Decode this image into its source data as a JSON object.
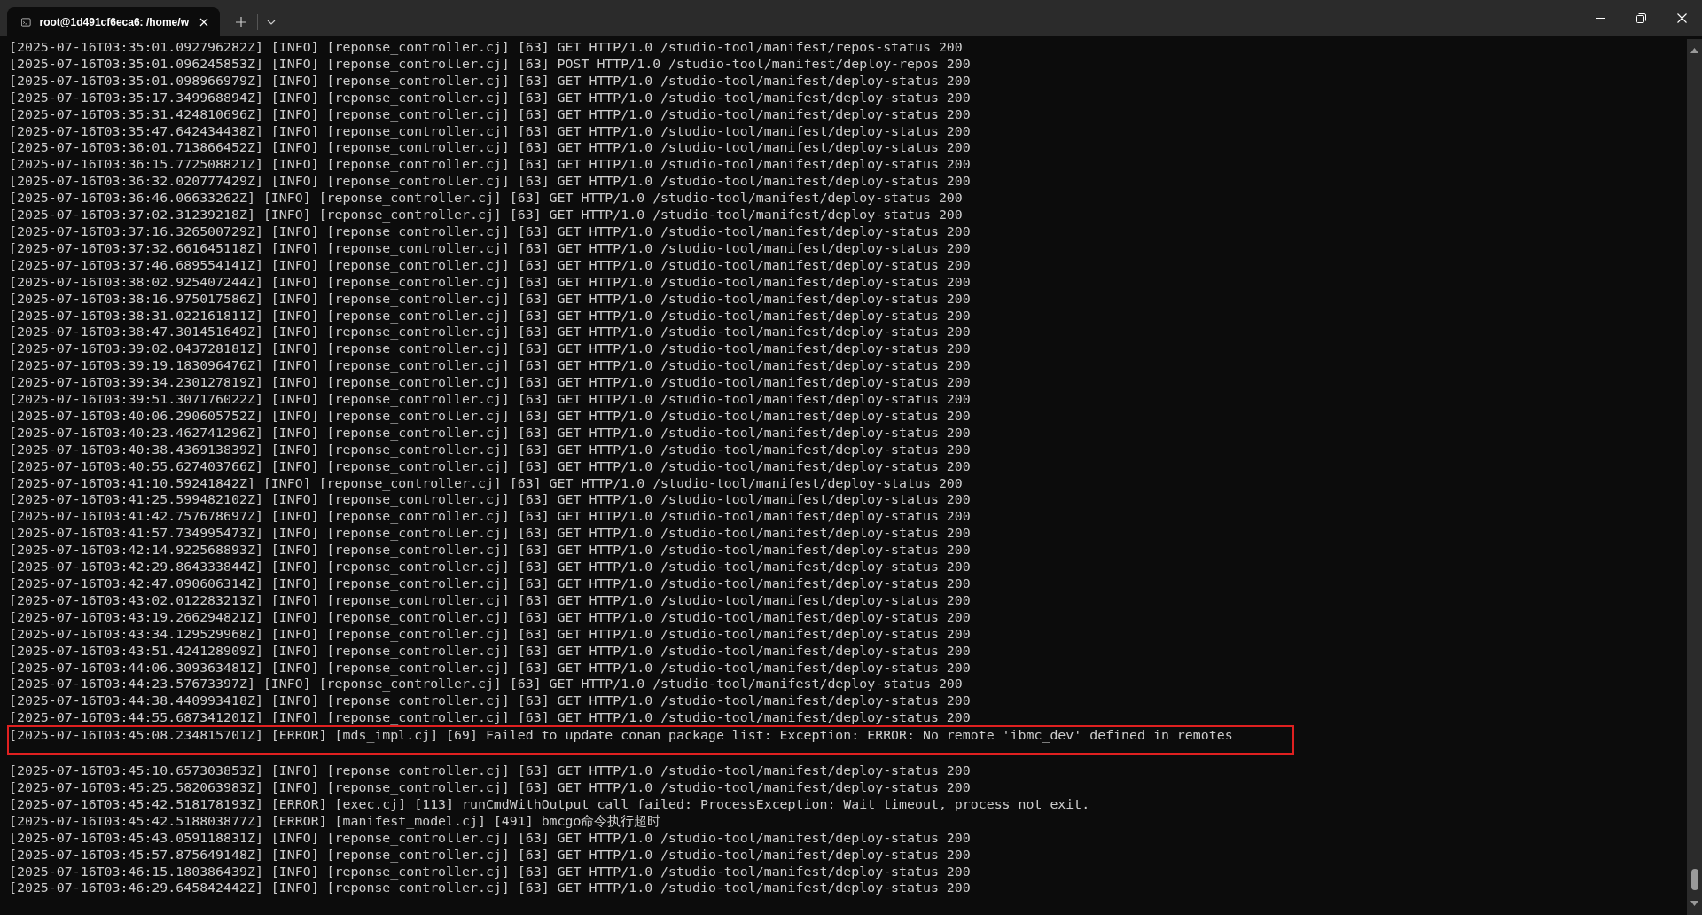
{
  "tab": {
    "title": "root@1d491cf6eca6: /home/w",
    "selected": true
  },
  "lines": [
    {
      "text": "[2025-07-16T03:35:01.092796282Z] [INFO] [reponse_controller.cj] [63] GET HTTP/1.0 /studio-tool/manifest/repos-status 200",
      "highlighted": false
    },
    {
      "text": "[2025-07-16T03:35:01.096245853Z] [INFO] [reponse_controller.cj] [63] POST HTTP/1.0 /studio-tool/manifest/deploy-repos 200",
      "highlighted": false
    },
    {
      "text": "[2025-07-16T03:35:01.098966979Z] [INFO] [reponse_controller.cj] [63] GET HTTP/1.0 /studio-tool/manifest/deploy-status 200",
      "highlighted": false
    },
    {
      "text": "[2025-07-16T03:35:17.349968894Z] [INFO] [reponse_controller.cj] [63] GET HTTP/1.0 /studio-tool/manifest/deploy-status 200",
      "highlighted": false
    },
    {
      "text": "[2025-07-16T03:35:31.424810696Z] [INFO] [reponse_controller.cj] [63] GET HTTP/1.0 /studio-tool/manifest/deploy-status 200",
      "highlighted": false
    },
    {
      "text": "[2025-07-16T03:35:47.642434438Z] [INFO] [reponse_controller.cj] [63] GET HTTP/1.0 /studio-tool/manifest/deploy-status 200",
      "highlighted": false
    },
    {
      "text": "[2025-07-16T03:36:01.713866452Z] [INFO] [reponse_controller.cj] [63] GET HTTP/1.0 /studio-tool/manifest/deploy-status 200",
      "highlighted": false
    },
    {
      "text": "[2025-07-16T03:36:15.772508821Z] [INFO] [reponse_controller.cj] [63] GET HTTP/1.0 /studio-tool/manifest/deploy-status 200",
      "highlighted": false
    },
    {
      "text": "[2025-07-16T03:36:32.020777429Z] [INFO] [reponse_controller.cj] [63] GET HTTP/1.0 /studio-tool/manifest/deploy-status 200",
      "highlighted": false
    },
    {
      "text": "[2025-07-16T03:36:46.06633262Z] [INFO] [reponse_controller.cj] [63] GET HTTP/1.0 /studio-tool/manifest/deploy-status 200",
      "highlighted": false
    },
    {
      "text": "[2025-07-16T03:37:02.31239218Z] [INFO] [reponse_controller.cj] [63] GET HTTP/1.0 /studio-tool/manifest/deploy-status 200",
      "highlighted": false
    },
    {
      "text": "[2025-07-16T03:37:16.326500729Z] [INFO] [reponse_controller.cj] [63] GET HTTP/1.0 /studio-tool/manifest/deploy-status 200",
      "highlighted": false
    },
    {
      "text": "[2025-07-16T03:37:32.661645118Z] [INFO] [reponse_controller.cj] [63] GET HTTP/1.0 /studio-tool/manifest/deploy-status 200",
      "highlighted": false
    },
    {
      "text": "[2025-07-16T03:37:46.689554141Z] [INFO] [reponse_controller.cj] [63] GET HTTP/1.0 /studio-tool/manifest/deploy-status 200",
      "highlighted": false
    },
    {
      "text": "[2025-07-16T03:38:02.925407244Z] [INFO] [reponse_controller.cj] [63] GET HTTP/1.0 /studio-tool/manifest/deploy-status 200",
      "highlighted": false
    },
    {
      "text": "[2025-07-16T03:38:16.975017586Z] [INFO] [reponse_controller.cj] [63] GET HTTP/1.0 /studio-tool/manifest/deploy-status 200",
      "highlighted": false
    },
    {
      "text": "[2025-07-16T03:38:31.022161811Z] [INFO] [reponse_controller.cj] [63] GET HTTP/1.0 /studio-tool/manifest/deploy-status 200",
      "highlighted": false
    },
    {
      "text": "[2025-07-16T03:38:47.301451649Z] [INFO] [reponse_controller.cj] [63] GET HTTP/1.0 /studio-tool/manifest/deploy-status 200",
      "highlighted": false
    },
    {
      "text": "[2025-07-16T03:39:02.043728181Z] [INFO] [reponse_controller.cj] [63] GET HTTP/1.0 /studio-tool/manifest/deploy-status 200",
      "highlighted": false
    },
    {
      "text": "[2025-07-16T03:39:19.183096476Z] [INFO] [reponse_controller.cj] [63] GET HTTP/1.0 /studio-tool/manifest/deploy-status 200",
      "highlighted": false
    },
    {
      "text": "[2025-07-16T03:39:34.230127819Z] [INFO] [reponse_controller.cj] [63] GET HTTP/1.0 /studio-tool/manifest/deploy-status 200",
      "highlighted": false
    },
    {
      "text": "[2025-07-16T03:39:51.307176022Z] [INFO] [reponse_controller.cj] [63] GET HTTP/1.0 /studio-tool/manifest/deploy-status 200",
      "highlighted": false
    },
    {
      "text": "[2025-07-16T03:40:06.290605752Z] [INFO] [reponse_controller.cj] [63] GET HTTP/1.0 /studio-tool/manifest/deploy-status 200",
      "highlighted": false
    },
    {
      "text": "[2025-07-16T03:40:23.462741296Z] [INFO] [reponse_controller.cj] [63] GET HTTP/1.0 /studio-tool/manifest/deploy-status 200",
      "highlighted": false
    },
    {
      "text": "[2025-07-16T03:40:38.436913839Z] [INFO] [reponse_controller.cj] [63] GET HTTP/1.0 /studio-tool/manifest/deploy-status 200",
      "highlighted": false
    },
    {
      "text": "[2025-07-16T03:40:55.627403766Z] [INFO] [reponse_controller.cj] [63] GET HTTP/1.0 /studio-tool/manifest/deploy-status 200",
      "highlighted": false
    },
    {
      "text": "[2025-07-16T03:41:10.59241842Z] [INFO] [reponse_controller.cj] [63] GET HTTP/1.0 /studio-tool/manifest/deploy-status 200",
      "highlighted": false
    },
    {
      "text": "[2025-07-16T03:41:25.599482102Z] [INFO] [reponse_controller.cj] [63] GET HTTP/1.0 /studio-tool/manifest/deploy-status 200",
      "highlighted": false
    },
    {
      "text": "[2025-07-16T03:41:42.757678697Z] [INFO] [reponse_controller.cj] [63] GET HTTP/1.0 /studio-tool/manifest/deploy-status 200",
      "highlighted": false
    },
    {
      "text": "[2025-07-16T03:41:57.734995473Z] [INFO] [reponse_controller.cj] [63] GET HTTP/1.0 /studio-tool/manifest/deploy-status 200",
      "highlighted": false
    },
    {
      "text": "[2025-07-16T03:42:14.922568893Z] [INFO] [reponse_controller.cj] [63] GET HTTP/1.0 /studio-tool/manifest/deploy-status 200",
      "highlighted": false
    },
    {
      "text": "[2025-07-16T03:42:29.864333844Z] [INFO] [reponse_controller.cj] [63] GET HTTP/1.0 /studio-tool/manifest/deploy-status 200",
      "highlighted": false
    },
    {
      "text": "[2025-07-16T03:42:47.090606314Z] [INFO] [reponse_controller.cj] [63] GET HTTP/1.0 /studio-tool/manifest/deploy-status 200",
      "highlighted": false
    },
    {
      "text": "[2025-07-16T03:43:02.012283213Z] [INFO] [reponse_controller.cj] [63] GET HTTP/1.0 /studio-tool/manifest/deploy-status 200",
      "highlighted": false
    },
    {
      "text": "[2025-07-16T03:43:19.266294821Z] [INFO] [reponse_controller.cj] [63] GET HTTP/1.0 /studio-tool/manifest/deploy-status 200",
      "highlighted": false
    },
    {
      "text": "[2025-07-16T03:43:34.129529968Z] [INFO] [reponse_controller.cj] [63] GET HTTP/1.0 /studio-tool/manifest/deploy-status 200",
      "highlighted": false
    },
    {
      "text": "[2025-07-16T03:43:51.424128909Z] [INFO] [reponse_controller.cj] [63] GET HTTP/1.0 /studio-tool/manifest/deploy-status 200",
      "highlighted": false
    },
    {
      "text": "[2025-07-16T03:44:06.309363481Z] [INFO] [reponse_controller.cj] [63] GET HTTP/1.0 /studio-tool/manifest/deploy-status 200",
      "highlighted": false
    },
    {
      "text": "[2025-07-16T03:44:23.57673397Z] [INFO] [reponse_controller.cj] [63] GET HTTP/1.0 /studio-tool/manifest/deploy-status 200",
      "highlighted": false
    },
    {
      "text": "[2025-07-16T03:44:38.440993418Z] [INFO] [reponse_controller.cj] [63] GET HTTP/1.0 /studio-tool/manifest/deploy-status 200",
      "highlighted": false
    },
    {
      "text": "[2025-07-16T03:44:55.687341201Z] [INFO] [reponse_controller.cj] [63] GET HTTP/1.0 /studio-tool/manifest/deploy-status 200",
      "highlighted": false
    },
    {
      "text": "[2025-07-16T03:45:08.234815701Z] [ERROR] [mds_impl.cj] [69] Failed to update conan package list: Exception: ERROR: No remote 'ibmc_dev' defined in remotes",
      "highlighted": true
    },
    {
      "text": "[2025-07-16T03:45:10.657303853Z] [INFO] [reponse_controller.cj] [63] GET HTTP/1.0 /studio-tool/manifest/deploy-status 200",
      "highlighted": false
    },
    {
      "text": "[2025-07-16T03:45:25.582063983Z] [INFO] [reponse_controller.cj] [63] GET HTTP/1.0 /studio-tool/manifest/deploy-status 200",
      "highlighted": false
    },
    {
      "text": "[2025-07-16T03:45:42.518178193Z] [ERROR] [exec.cj] [113] runCmdWithOutput call failed: ProcessException: Wait timeout, process not exit.",
      "highlighted": false
    },
    {
      "text": "[2025-07-16T03:45:42.518803877Z] [ERROR] [manifest_model.cj] [491] bmcgo命令执行超时",
      "highlighted": false
    },
    {
      "text": "[2025-07-16T03:45:43.059118831Z] [INFO] [reponse_controller.cj] [63] GET HTTP/1.0 /studio-tool/manifest/deploy-status 200",
      "highlighted": false
    },
    {
      "text": "[2025-07-16T03:45:57.875649148Z] [INFO] [reponse_controller.cj] [63] GET HTTP/1.0 /studio-tool/manifest/deploy-status 200",
      "highlighted": false
    },
    {
      "text": "[2025-07-16T03:46:15.180386439Z] [INFO] [reponse_controller.cj] [63] GET HTTP/1.0 /studio-tool/manifest/deploy-status 200",
      "highlighted": false
    },
    {
      "text": "[2025-07-16T03:46:29.645842442Z] [INFO] [reponse_controller.cj] [63] GET HTTP/1.0 /studio-tool/manifest/deploy-status 200",
      "highlighted": false
    }
  ]
}
